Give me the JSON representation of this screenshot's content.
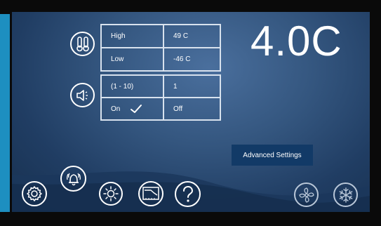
{
  "temperature": {
    "current": "4.0C"
  },
  "temp_table": {
    "high_label": "High",
    "high_value": "49 C",
    "low_label": "Low",
    "low_value": "-46 C"
  },
  "sound_table": {
    "range_label": "(1 - 10)",
    "range_value": "1",
    "on_label": "On",
    "off_label": "Off"
  },
  "advanced_settings_label": "Advanced Settings",
  "icons": {
    "thermometer": "thermometer-icon",
    "speaker": "speaker-icon",
    "settings": "gear-icon",
    "alarm": "bell-alarm-icon",
    "brightness": "sun-icon",
    "graph": "graph-icon",
    "help": "help-icon",
    "fan": "fan-icon",
    "defrost": "snowflake-icon"
  },
  "colors": {
    "accent": "#1d8fc0",
    "button": "#123a67",
    "background": "#2b4b74"
  }
}
